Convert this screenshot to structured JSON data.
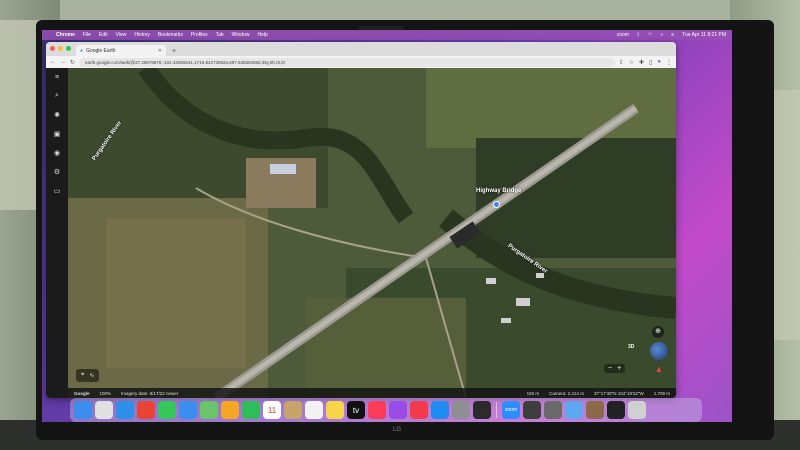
{
  "menubar": {
    "app": "Chrome",
    "items": [
      "File",
      "Edit",
      "View",
      "History",
      "Bookmarks",
      "Profiles",
      "Tab",
      "Window",
      "Help"
    ],
    "right": {
      "zoom": "zoom",
      "datetime": "Tue Apr 11  8:21 PM"
    }
  },
  "browser": {
    "tab_title": "Google Earth",
    "url": "earth.google.com/web/@37.29678878,-104.32060641,1716.84273982a,697.53550298d,35y,0h,0t,0r"
  },
  "map": {
    "labels": {
      "highway_bridge": "Highway Bridge",
      "river_top_left": "Purgatoire River",
      "river_right": "Purgatoire River"
    },
    "status": {
      "brand": "Google",
      "zoom_pct": "100%",
      "imagery_date": "Imagery date: 9/17/22  newer",
      "scale": "150 m",
      "camera": "Camera: 2,414 m",
      "coords": "37°17'48\"N 104°19'22\"W",
      "elevation": "1,709 m"
    },
    "controls": {
      "three_d": "3D",
      "zoom_out": "−",
      "zoom_in": "+"
    }
  },
  "dock": {
    "apps": [
      {
        "name": "finder",
        "color": "#3b8df0"
      },
      {
        "name": "launchpad",
        "color": "#e0e0e0"
      },
      {
        "name": "safari",
        "color": "#2f8fe8"
      },
      {
        "name": "chrome",
        "color": "#e94335"
      },
      {
        "name": "messages",
        "color": "#35c759"
      },
      {
        "name": "mail",
        "color": "#3a8ef0"
      },
      {
        "name": "maps",
        "color": "#6cc36a"
      },
      {
        "name": "photos",
        "color": "#f5a623"
      },
      {
        "name": "facetime",
        "color": "#2ebd59"
      },
      {
        "name": "calendar",
        "color": "#ffffff",
        "text": "11"
      },
      {
        "name": "contacts",
        "color": "#c8a36a"
      },
      {
        "name": "reminders",
        "color": "#f2f2f2"
      },
      {
        "name": "notes",
        "color": "#f7d54a"
      },
      {
        "name": "tv",
        "color": "#111111",
        "text": "tv"
      },
      {
        "name": "music",
        "color": "#fa3b5a"
      },
      {
        "name": "podcasts",
        "color": "#9b4ce6"
      },
      {
        "name": "news",
        "color": "#f33a4a"
      },
      {
        "name": "app-store",
        "color": "#1e8cf3"
      },
      {
        "name": "system-settings",
        "color": "#8e8e93"
      },
      {
        "name": "davinci",
        "color": "#2b2b2b"
      },
      {
        "name": "zoom",
        "color": "#2d8cff",
        "text": "zoom"
      },
      {
        "name": "quicktime",
        "color": "#3e3e3e"
      },
      {
        "name": "preview",
        "color": "#6a6a6a"
      },
      {
        "name": "folder",
        "color": "#5ea8f2"
      },
      {
        "name": "photo-stack",
        "color": "#8a6a4a"
      },
      {
        "name": "screenshot",
        "color": "#222222"
      },
      {
        "name": "trash",
        "color": "#d0d0d0"
      }
    ]
  }
}
